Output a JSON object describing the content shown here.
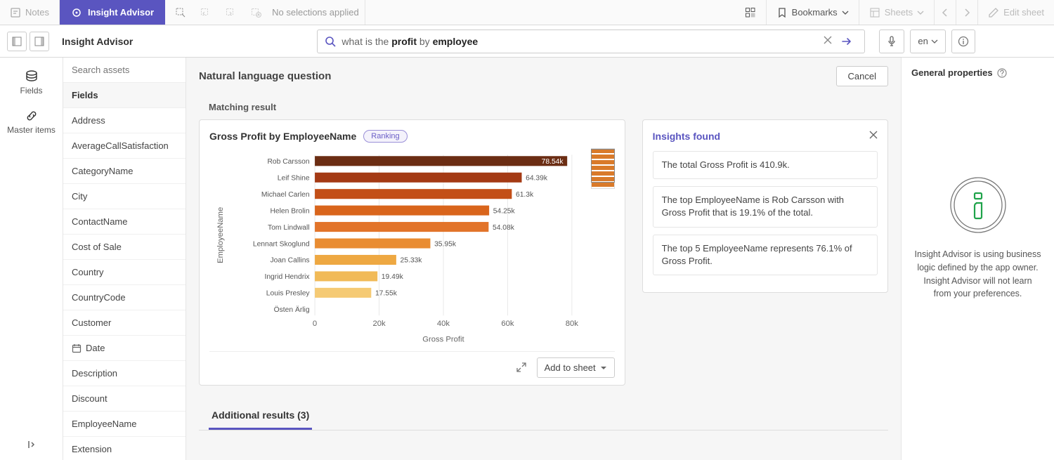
{
  "toolbar": {
    "notes": "Notes",
    "insight_advisor": "Insight Advisor",
    "no_selections": "No selections applied",
    "bookmarks": "Bookmarks",
    "sheets": "Sheets",
    "edit_sheet": "Edit sheet"
  },
  "subbar": {
    "title": "Insight Advisor",
    "search_prefix": "what is the ",
    "search_bold1": "profit",
    "search_mid": " by ",
    "search_bold2": "employee",
    "lang": "en"
  },
  "left_rail": {
    "fields": "Fields",
    "master_items": "Master items"
  },
  "fields_panel": {
    "search_placeholder": "Search assets",
    "header": "Fields",
    "items": [
      {
        "label": "Address"
      },
      {
        "label": "AverageCallSatisfaction"
      },
      {
        "label": "CategoryName"
      },
      {
        "label": "City"
      },
      {
        "label": "ContactName"
      },
      {
        "label": "Cost of Sale"
      },
      {
        "label": "Country"
      },
      {
        "label": "CountryCode"
      },
      {
        "label": "Customer"
      },
      {
        "label": "Date",
        "icon": "date"
      },
      {
        "label": "Description"
      },
      {
        "label": "Discount"
      },
      {
        "label": "EmployeeName"
      },
      {
        "label": "Extension"
      }
    ]
  },
  "nlq": {
    "title": "Natural language question",
    "cancel": "Cancel",
    "matching": "Matching result"
  },
  "card": {
    "title": "Gross Profit by EmployeeName",
    "pill": "Ranking",
    "add_to_sheet": "Add to sheet",
    "additional_results": "Additional results (3)"
  },
  "chart_data": {
    "type": "bar",
    "orientation": "horizontal",
    "title": "Gross Profit by EmployeeName",
    "xlabel": "Gross Profit",
    "ylabel": "EmployeeName",
    "x_ticks": [
      "0",
      "20k",
      "40k",
      "60k",
      "80k"
    ],
    "xlim": [
      0,
      80000
    ],
    "categories": [
      "Rob Carsson",
      "Leif Shine",
      "Michael Carlen",
      "Helen Brolin",
      "Tom Lindwall",
      "Lennart Skoglund",
      "Joan Callins",
      "Ingrid Hendrix",
      "Louis Presley",
      "Östen Ärlig"
    ],
    "values": [
      78540,
      64390,
      61300,
      54250,
      54080,
      35950,
      25330,
      19490,
      17550,
      0
    ],
    "value_labels": [
      "78.54k",
      "64.39k",
      "61.3k",
      "54.25k",
      "54.08k",
      "35.95k",
      "25.33k",
      "19.49k",
      "17.55k",
      ""
    ],
    "colors": [
      "#6b2d13",
      "#a43a14",
      "#c34f17",
      "#d9651c",
      "#e2742a",
      "#e98c32",
      "#eea842",
      "#f1ba57",
      "#f5ca74",
      "#f8d78e"
    ]
  },
  "insights": {
    "heading": "Insights found",
    "items": [
      "The total Gross Profit is 410.9k.",
      "The top EmployeeName is Rob Carsson with Gross Profit that is 19.1% of the total.",
      "The top 5 EmployeeName represents 76.1% of Gross Profit."
    ]
  },
  "right_panel": {
    "heading": "General properties",
    "body": "Insight Advisor is using business logic defined by the app owner. Insight Advisor will not learn from your preferences."
  }
}
